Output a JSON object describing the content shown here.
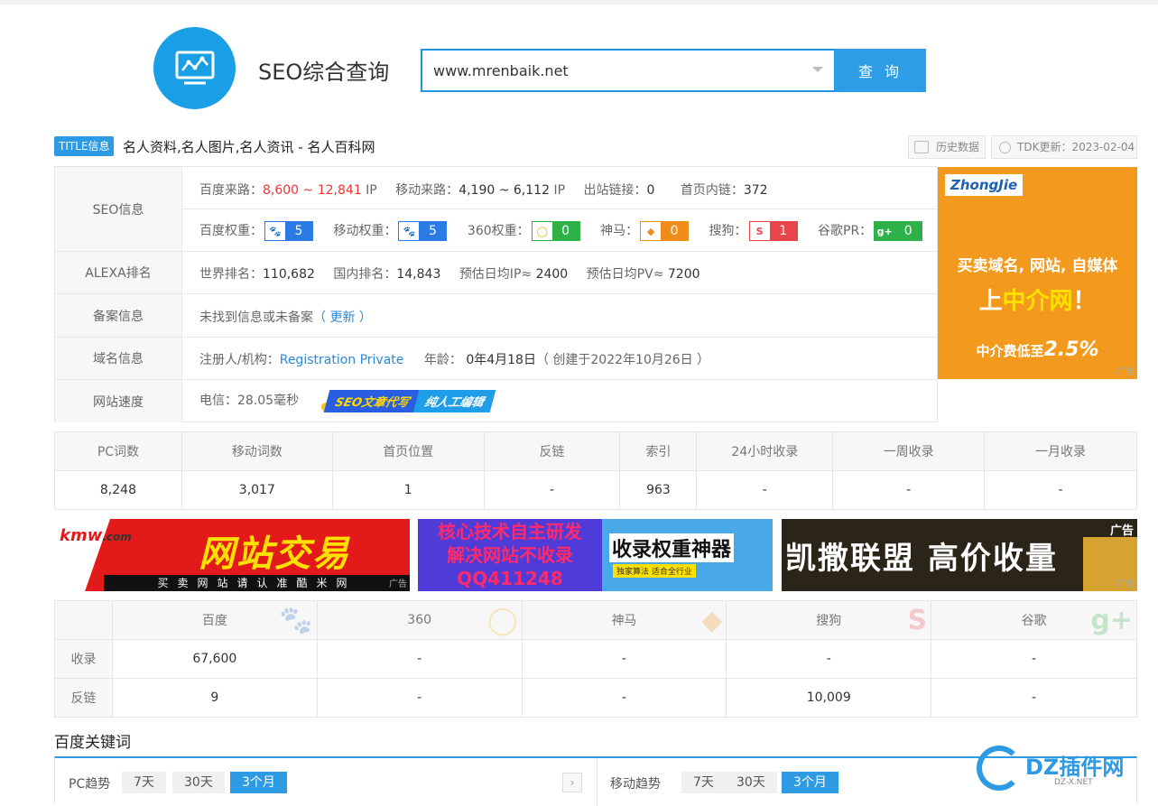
{
  "header": {
    "site_title": "SEO综合查询",
    "search_value": "www.mrenbaik.net",
    "search_button": "查 询"
  },
  "title_row": {
    "tag": "TITLE信息",
    "title": "名人资料,名人图片,名人资讯 - 名人百科网",
    "history_btn": "历史数据",
    "tdk_btn": "TDK更新：2023-02-04"
  },
  "seo_info": {
    "label": "SEO信息",
    "baidu_source_label": "百度来路：",
    "baidu_source_value": "8,600 ~ 12,841",
    "baidu_source_unit": "IP",
    "mobile_source_label": "移动来路：",
    "mobile_source_value": "4,190 ~ 6,112",
    "mobile_source_unit": "IP",
    "outlinks_label": "出站链接：",
    "outlinks_value": "0",
    "homepage_inlinks_label": "首页内链：",
    "homepage_inlinks_value": "372",
    "weights": [
      {
        "label": "百度权重：",
        "value": "5",
        "icon": "baidu-paw-icon",
        "color": "#2b7be4"
      },
      {
        "label": "移动权重：",
        "value": "5",
        "icon": "baidu-paw-icon",
        "color": "#2b7be4"
      },
      {
        "label": "360权重：",
        "value": "0",
        "icon": "360-icon",
        "color": "#2fb14a"
      },
      {
        "label": "神马：",
        "value": "0",
        "icon": "shenma-icon",
        "color": "#f08c1a"
      },
      {
        "label": "搜狗：",
        "value": "1",
        "icon": "sogou-icon",
        "color": "#e8454a"
      },
      {
        "label": "谷歌PR：",
        "value": "0",
        "icon": "google-plus-icon",
        "color": "#2fb14a"
      }
    ]
  },
  "alexa": {
    "label": "ALEXA排名",
    "world_label": "世界排名：",
    "world_value": "110,682",
    "cn_label": "国内排名：",
    "cn_value": "14,843",
    "ip_label": "预估日均IP≈",
    "ip_value": "2400",
    "pv_label": "预估日均PV≈",
    "pv_value": "7200"
  },
  "icp": {
    "label": "备案信息",
    "text": "未找到信息或未备案",
    "update_link": "（ 更新 ）"
  },
  "domain": {
    "label": "域名信息",
    "registrant_label": "注册人/机构：",
    "registrant_value": "Registration Private",
    "age_label": "年龄：",
    "age_value": "0年4月18日",
    "created": "（ 创建于2022年10月26日 ）"
  },
  "speed": {
    "label": "网站速度",
    "value": "电信：28.05毫秒",
    "ribbon_1": "SEO文章代写",
    "ribbon_2": "纯人工编辑"
  },
  "ad_right": {
    "brand": "ZhongJie",
    "line1": "买卖域名, 网站, 自媒体",
    "line2_a": "上",
    "line2_b": "中介网",
    "line2_c": "！",
    "line3_a": "中介费低至",
    "line3_b": "2.5%",
    "tag": "广告"
  },
  "stats": {
    "headers": [
      "PC词数",
      "移动词数",
      "首页位置",
      "反链",
      "索引",
      "24小时收录",
      "一周收录",
      "一月收录"
    ],
    "values": [
      "8,248",
      "3,017",
      "1",
      "-",
      "963",
      "-",
      "-",
      "-"
    ]
  },
  "banners": {
    "b1_brand_a": "kmw",
    "b1_brand_b": ".com",
    "b1_big": "网站交易",
    "b1_strip": "买卖网站请认准酷米网",
    "b1_tag": "广告",
    "b2_l1": "核心技术自主研发",
    "b2_l2": "解决网站不收录",
    "b2_l3": "QQ411248",
    "b2_r": "收录权重神器",
    "b2_r_sub": "独家算法 适合全行业",
    "b3_text": "凯撒联盟 高价收量",
    "b3_tag": "广告",
    "b3_tag2": "广告"
  },
  "engines": {
    "headers": [
      "",
      "百度",
      "360",
      "神马",
      "搜狗",
      "谷歌"
    ],
    "rows": [
      {
        "label": "收录",
        "values": [
          "67,600",
          "-",
          "-",
          "-",
          "-"
        ]
      },
      {
        "label": "反链",
        "values": [
          "9",
          "-",
          "-",
          "10,009",
          "-"
        ]
      }
    ]
  },
  "keywords": {
    "title": "百度关键词",
    "pc_label": "PC趋势",
    "mobile_label": "移动趋势",
    "ranges": [
      "7天",
      "30天",
      "3个月"
    ]
  },
  "watermark": {
    "name": "DZ插件网",
    "url": "DZ-X.NET"
  }
}
